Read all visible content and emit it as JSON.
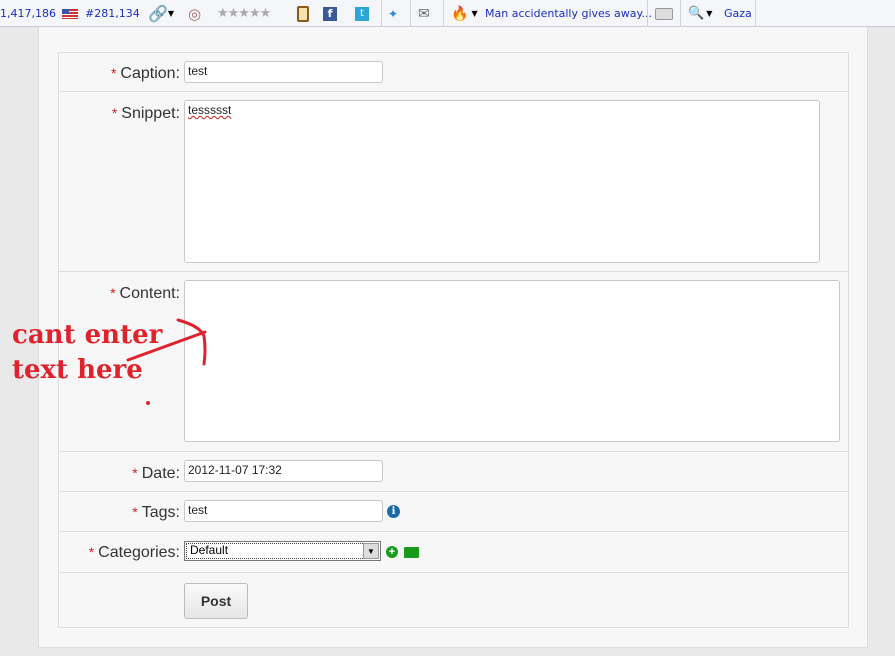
{
  "toolbar": {
    "traffic_rank": "1,417,186",
    "country_rank": "#281,134",
    "news_headline": "Man accidentally gives away...",
    "search_term": "Gaza"
  },
  "form": {
    "caption": {
      "label": "Caption:",
      "value": "test"
    },
    "snippet": {
      "label": "Snippet:",
      "value": "tessssst"
    },
    "content": {
      "label": "Content:",
      "value": ""
    },
    "date": {
      "label": "Date:",
      "value": "2012-11-07 17:32"
    },
    "tags": {
      "label": "Tags:",
      "value": "test"
    },
    "categories": {
      "label": "Categories:",
      "value": "Default"
    },
    "required_mark": "*",
    "post_label": "Post"
  },
  "annotation": {
    "line1": "cant enter",
    "line2": "text here"
  },
  "colors": {
    "required": "#d42020",
    "annotation": "#e0222c",
    "link": "#1a2fbf"
  }
}
